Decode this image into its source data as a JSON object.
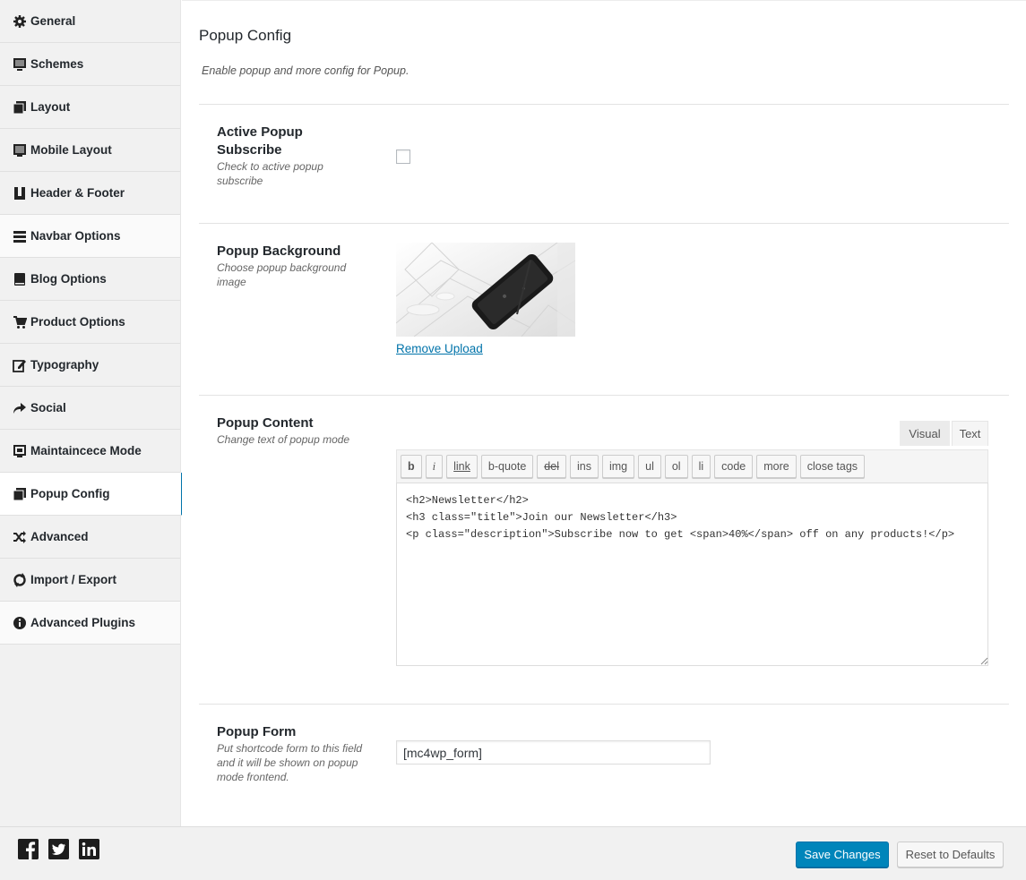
{
  "sidebar": {
    "items": [
      {
        "label": "General",
        "icon": "gear-icon"
      },
      {
        "label": "Schemes",
        "icon": "monitor-icon"
      },
      {
        "label": "Layout",
        "icon": "copy-icon"
      },
      {
        "label": "Mobile Layout",
        "icon": "tablet-icon"
      },
      {
        "label": "Header & Footer",
        "icon": "header-footer-icon"
      },
      {
        "label": "Navbar Options",
        "icon": "bars-icon"
      },
      {
        "label": "Blog Options",
        "icon": "book-icon"
      },
      {
        "label": "Product Options",
        "icon": "cart-icon"
      },
      {
        "label": "Typography",
        "icon": "edit-icon"
      },
      {
        "label": "Social",
        "icon": "share-icon"
      },
      {
        "label": "Maintaincece Mode",
        "icon": "maintenance-icon"
      },
      {
        "label": "Popup Config",
        "icon": "copy-icon"
      },
      {
        "label": "Advanced",
        "icon": "shuffle-icon"
      },
      {
        "label": "Import / Export",
        "icon": "refresh-icon"
      },
      {
        "label": "Advanced Plugins",
        "icon": "info-icon"
      }
    ],
    "active": "Popup Config"
  },
  "section": {
    "title": "Popup Config",
    "description": "Enable popup and more config for Popup."
  },
  "fields": {
    "active_popup": {
      "title": "Active Popup Subscribe",
      "subtitle": "Check to active popup subscribe",
      "checked": false
    },
    "background": {
      "title": "Popup Background",
      "subtitle": "Choose popup background image",
      "remove_label": "Remove Upload"
    },
    "content": {
      "title": "Popup Content",
      "subtitle": "Change text of popup mode",
      "tabs": {
        "visual": "Visual",
        "text": "Text"
      },
      "buttons": [
        "b",
        "i",
        "link",
        "b-quote",
        "del",
        "ins",
        "img",
        "ul",
        "ol",
        "li",
        "code",
        "more",
        "close tags"
      ],
      "value": "<h2>Newsletter</h2>\n<h3 class=\"title\">Join our Newsletter</h3>\n<p class=\"description\">Subscribe now to get <span>40%</span> off on any products!</p>"
    },
    "form": {
      "title": "Popup Form",
      "subtitle": "Put shortcode form to this field and it will be shown on popup mode frontend.",
      "value": "[mc4wp_form]"
    }
  },
  "footer": {
    "social": [
      "facebook-icon",
      "twitter-icon",
      "linkedin-icon"
    ],
    "save_label": "Save Changes",
    "reset_label": "Reset to Defaults"
  },
  "colors": {
    "accent": "#0085ba",
    "link": "#0073aa"
  }
}
